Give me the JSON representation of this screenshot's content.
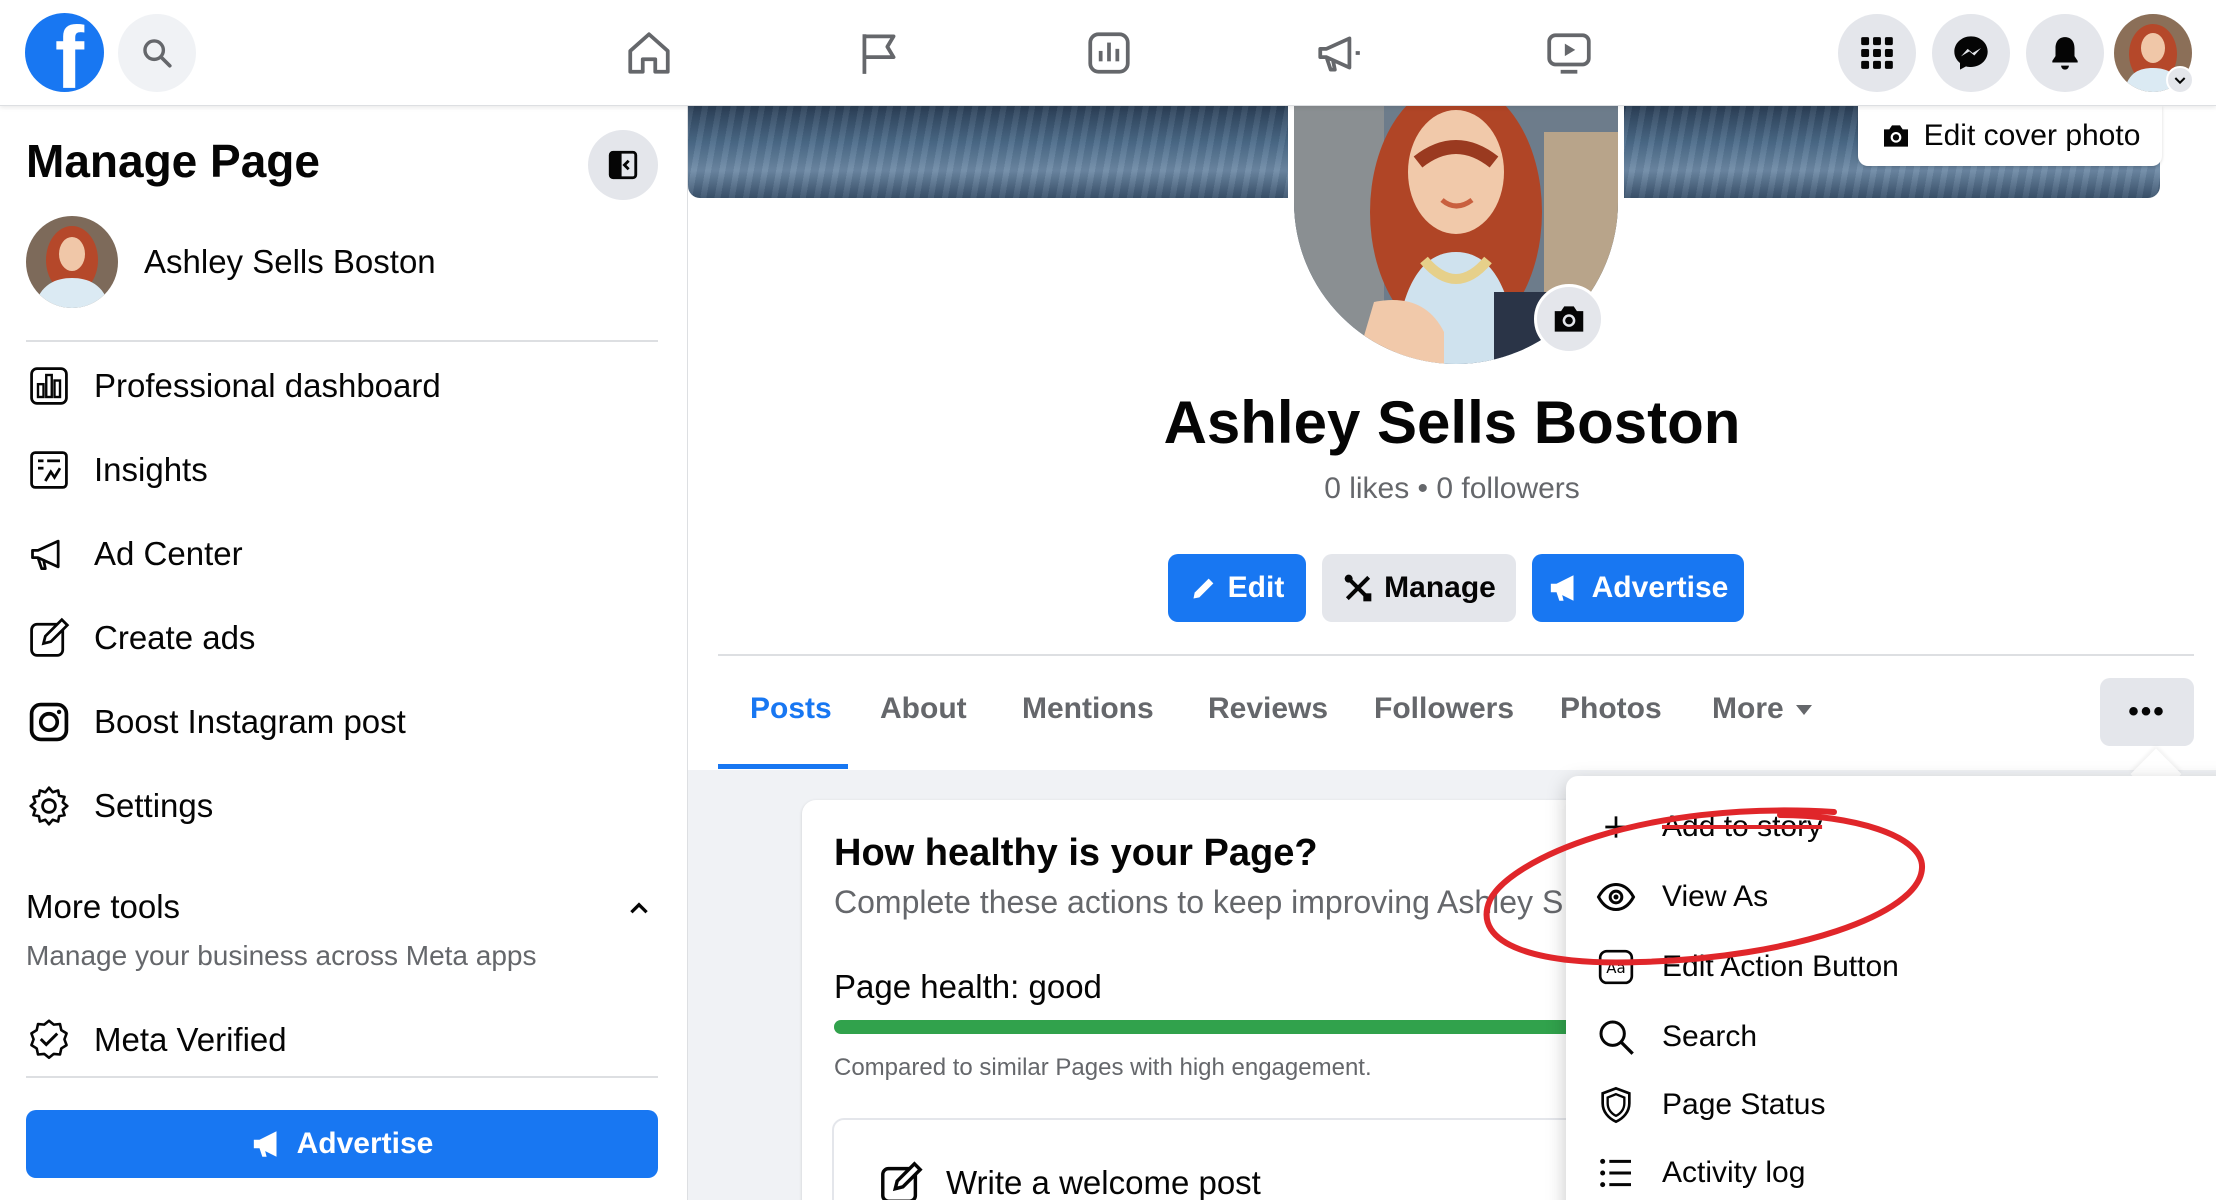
{
  "topbar": {
    "logo_letter": "f",
    "nav": [
      "home-icon",
      "flag-icon",
      "dashboard-icon",
      "megaphone-icon",
      "video-icon"
    ],
    "right": [
      "menu-grid-icon",
      "messenger-icon",
      "bell-icon"
    ]
  },
  "sidebar": {
    "title": "Manage Page",
    "page_name": "Ashley Sells Boston",
    "items": [
      {
        "label": "Professional dashboard",
        "icon": "dashboard-icon"
      },
      {
        "label": "Insights",
        "icon": "insights-icon"
      },
      {
        "label": "Ad Center",
        "icon": "megaphone-icon"
      },
      {
        "label": "Create ads",
        "icon": "edit-icon"
      },
      {
        "label": "Boost Instagram post",
        "icon": "instagram-icon"
      },
      {
        "label": "Settings",
        "icon": "gear-icon"
      }
    ],
    "more_tools": {
      "title": "More tools",
      "subtitle": "Manage your business across Meta apps"
    },
    "meta_verified": "Meta Verified",
    "advertise_label": "Advertise"
  },
  "profile": {
    "edit_cover_label": "Edit cover photo",
    "name": "Ashley Sells Boston",
    "stats": "0 likes • 0 followers",
    "buttons": {
      "edit": "Edit",
      "manage": "Manage",
      "advertise": "Advertise"
    },
    "tabs": [
      "Posts",
      "About",
      "Mentions",
      "Reviews",
      "Followers",
      "Photos",
      "More"
    ],
    "active_tab": "Posts",
    "dots_label": "•••"
  },
  "health": {
    "title": "How healthy is your Page?",
    "subtitle": "Complete these actions to keep improving Ashley S",
    "status": "Page health: good",
    "progress": 1.0,
    "compare": "Compared to similar Pages with high engagement.",
    "welcome": "Write a welcome post"
  },
  "dropdown": {
    "items": [
      {
        "label": "Add to story",
        "icon": "plus-icon"
      },
      {
        "label": "View As",
        "icon": "eye-icon"
      },
      {
        "label": "Edit Action Button",
        "icon": "action-button-icon"
      },
      {
        "label": "Search",
        "icon": "search-icon"
      },
      {
        "label": "Page Status",
        "icon": "shield-icon"
      },
      {
        "label": "Activity log",
        "icon": "list-icon"
      }
    ]
  },
  "colors": {
    "brand": "#1877f2",
    "annotation": "#e0262a",
    "health_good": "#31a24c"
  }
}
